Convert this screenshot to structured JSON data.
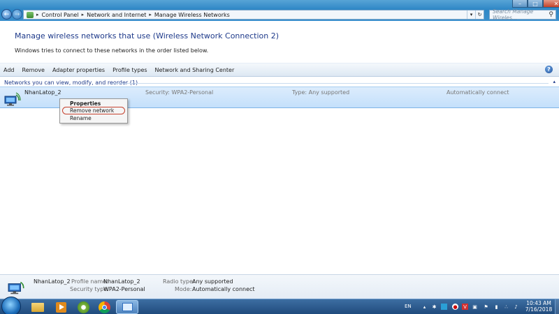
{
  "window": {
    "controls": {
      "minimize": "–",
      "maximize": "□",
      "close": "✕"
    },
    "nav": {
      "back": "←",
      "forward": "→"
    }
  },
  "address": {
    "crumbs": [
      "Control Panel",
      "Network and Internet",
      "Manage Wireless Networks"
    ],
    "dropdown": "▾",
    "refresh": "↻"
  },
  "search": {
    "placeholder": "Search Manage Wireles...",
    "icon": "search-icon"
  },
  "header": {
    "title": "Manage wireless networks that use (Wireless Network Connection 2)",
    "description": "Windows tries to connect to these networks in the order listed below."
  },
  "toolbar": {
    "add": "Add",
    "remove": "Remove",
    "adapter_properties": "Adapter properties",
    "profile_types": "Profile types",
    "network_sharing_center": "Network and Sharing Center",
    "help": "?"
  },
  "group": {
    "label": "Networks you can view, modify, and reorder (1)",
    "collapse": "▴"
  },
  "network": {
    "name": "NhanLatop_2",
    "security": "Security: WPA2-Personal",
    "type": "Type: Any supported",
    "connect": "Automatically connect"
  },
  "context_menu": {
    "properties": "Properties",
    "remove_network": "Remove network",
    "rename": "Rename"
  },
  "details": {
    "name": "NhanLatop_2",
    "profile_name_label": "Profile name:",
    "profile_name_value": "NhanLatop_2",
    "security_type_label": "Security type:",
    "security_type_value": "WPA2-Personal",
    "radio_type_label": "Radio type:",
    "radio_type_value": "Any supported",
    "mode_label": "Mode:",
    "mode_value": "Automatically connect"
  },
  "taskbar": {
    "language": "EN",
    "time": "10:43 AM",
    "date": "7/16/2018"
  },
  "colors": {
    "title_blue": "#1e3a8a",
    "selection": "#c4e0fb",
    "highlight_ring": "#c5412d",
    "taskbar": "#204b7d"
  }
}
